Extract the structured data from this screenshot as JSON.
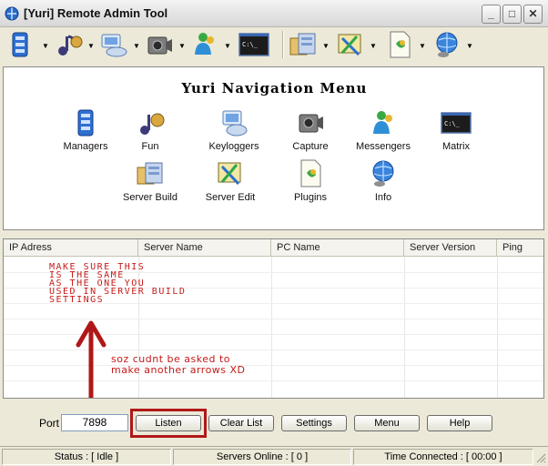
{
  "window": {
    "title": "[Yuri] Remote Admin Tool"
  },
  "controls": {
    "minimize": "_",
    "maximize": "□",
    "close": "✕"
  },
  "toolbar": {
    "items": [
      {
        "name": "managers-icon"
      },
      {
        "name": "fun-icon"
      },
      {
        "name": "keyloggers-icon"
      },
      {
        "name": "capture-icon"
      },
      {
        "name": "messengers-icon"
      },
      {
        "name": "matrix-icon"
      },
      {
        "name": "server-build-icon"
      },
      {
        "name": "server-edit-icon"
      },
      {
        "name": "plugins-icon"
      },
      {
        "name": "info-icon"
      }
    ],
    "dropdown_glyph": "▼"
  },
  "nav": {
    "title": "Yuri Navigation Menu",
    "items": [
      {
        "label": "Managers"
      },
      {
        "label": "Fun"
      },
      {
        "label": "Keyloggers"
      },
      {
        "label": "Capture"
      },
      {
        "label": "Messengers"
      },
      {
        "label": "Matrix"
      },
      {
        "label": "Server Build"
      },
      {
        "label": "Server Edit"
      },
      {
        "label": "Plugins"
      },
      {
        "label": "Info"
      }
    ]
  },
  "list": {
    "columns": [
      "IP Adress",
      "Server Name",
      "PC Name",
      "Server Version",
      "Ping"
    ],
    "annotation1": [
      "MAKE SURE THIS",
      "IS THE SAME",
      "AS THE ONE YOU",
      "USED IN SERVER BUILD",
      "SETTINGS"
    ],
    "annotation2": [
      "soz cudnt be asked to",
      "make another arrows XD"
    ]
  },
  "controls_bar": {
    "port_label": "Port",
    "port_value": "7898",
    "listen": "Listen",
    "clear_list": "Clear List",
    "settings": "Settings",
    "menu": "Menu",
    "help": "Help"
  },
  "status": {
    "status": "Status : [ Idle ]",
    "servers_online": "Servers Online : [ 0 ]",
    "time_connected": "Time Connected : [ 00:00 ]"
  },
  "colors": {
    "annotation": "#c61a1a",
    "highlight": "#b01818"
  }
}
